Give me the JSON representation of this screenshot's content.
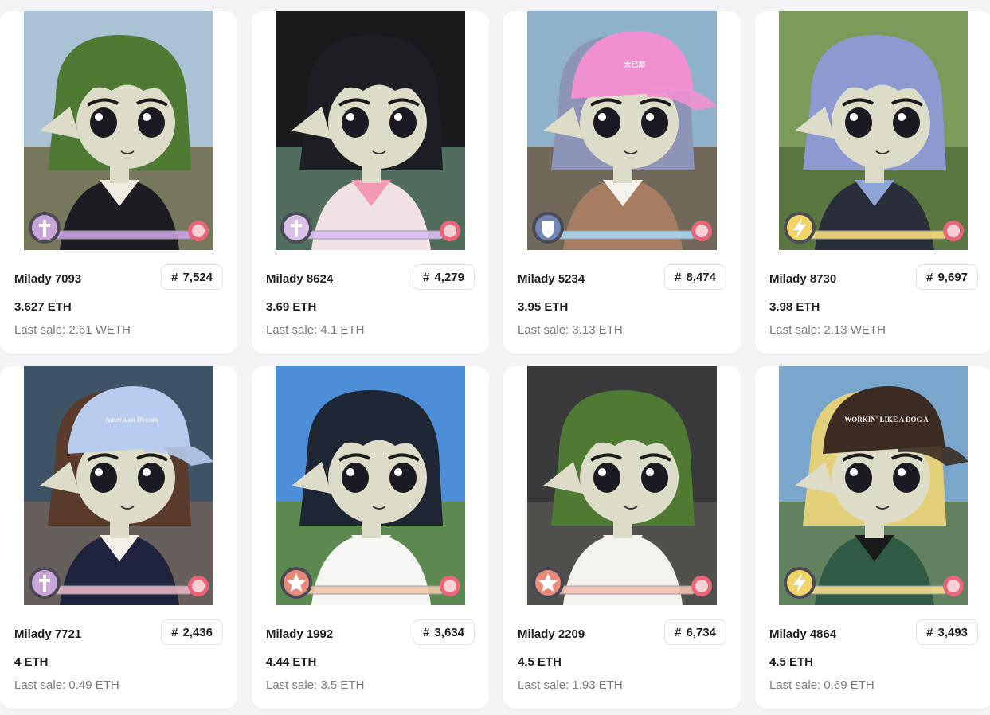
{
  "cards": [
    {
      "name": "Milady 7093",
      "rank_hash": "#",
      "rank": "7,524",
      "price": "3.627 ETH",
      "last_label": "Last sale:",
      "last_value": "2.61 WETH",
      "art": {
        "sky": "#a9c2d6",
        "ground": "#6d6a45",
        "hair": "#4f7a34",
        "outfit": "#1e1c22",
        "collar": "#f1ece2",
        "hat": "none",
        "hat_color": "",
        "hat_text": "",
        "badge": "cross-icon",
        "badge_color": "#c8a4d8",
        "bar": "#c8a4e6"
      }
    },
    {
      "name": "Milady 8624",
      "rank_hash": "#",
      "rank": "4,279",
      "price": "3.69 ETH",
      "last_label": "Last sale:",
      "last_value": "4.1 ETH",
      "art": {
        "sky": "#1a1a1c",
        "ground": "#5a7d6a",
        "hair": "#1d1e24",
        "outfit": "#f0e2e4",
        "collar": "#f39ab4",
        "hat": "none",
        "hat_color": "",
        "hat_text": "",
        "badge": "cross-icon",
        "badge_color": "#d8c0e8",
        "bar": "#d8c0f2"
      }
    },
    {
      "name": "Milady 5234",
      "rank_hash": "#",
      "rank": "8,474",
      "price": "3.95 ETH",
      "last_label": "Last sale:",
      "last_value": "3.13 ETH",
      "art": {
        "sky": "#8fb2cc",
        "ground": "#6b5a45",
        "hair": "#8e93b8",
        "outfit": "#a77d62",
        "collar": "#f5f2ee",
        "hat": "cap",
        "hat_color": "#f08fd0",
        "hat_text": "太巳郎",
        "badge": "shield-icon",
        "badge_color": "#6f86b8",
        "bar": "#a9d6f0"
      }
    },
    {
      "name": "Milady 8730",
      "rank_hash": "#",
      "rank": "9,697",
      "price": "3.98 ETH",
      "last_label": "Last sale:",
      "last_value": "2.13 WETH",
      "art": {
        "sky": "#7c9a5a",
        "ground": "#56703d",
        "hair": "#8d9ad0",
        "outfit": "#2a2e38",
        "collar": "#8da6d8",
        "hat": "none",
        "hat_color": "",
        "hat_text": "",
        "badge": "bolt-icon",
        "badge_color": "#f0d46a",
        "bar": "#f3de7c"
      }
    },
    {
      "name": "Milady 7721",
      "rank_hash": "#",
      "rank": "2,436",
      "price": "4 ETH",
      "last_label": "Last sale:",
      "last_value": "0.49 ETH",
      "art": {
        "sky": "#3d5466",
        "ground": "#6f625a",
        "hair": "#5a3a2a",
        "outfit": "#20233d",
        "collar": "#f3f0ea",
        "hat": "cap",
        "hat_color": "#b8ccef",
        "hat_text": "American Dream",
        "badge": "cross-icon",
        "badge_color": "#c8a4d8",
        "bar": "#e8b6c4"
      }
    },
    {
      "name": "Milady 1992",
      "rank_hash": "#",
      "rank": "3,634",
      "price": "4.44 ETH",
      "last_label": "Last sale:",
      "last_value": "3.5 ETH",
      "art": {
        "sky": "#4d8fd6",
        "ground": "#5f8a3a",
        "hair": "#1e2634",
        "outfit": "#f6f6f4",
        "collar": "#f6f6f4",
        "hat": "none",
        "hat_color": "",
        "hat_text": "",
        "badge": "star-icon",
        "badge_color": "#e88a7a",
        "bar": "#f0c8a8"
      }
    },
    {
      "name": "Milady 2209",
      "rank_hash": "#",
      "rank": "6,734",
      "price": "4.5 ETH",
      "last_label": "Last sale:",
      "last_value": "1.93 ETH",
      "art": {
        "sky": "#3a3a3c",
        "ground": "#55554f",
        "hair": "#4f7a34",
        "outfit": "#f3f2ee",
        "collar": "#f3f2ee",
        "hat": "none",
        "hat_color": "",
        "hat_text": "",
        "badge": "star-icon",
        "badge_color": "#e88a7a",
        "bar": "#f2c2b0"
      }
    },
    {
      "name": "Milady 4864",
      "rank_hash": "#",
      "rank": "3,493",
      "price": "4.5 ETH",
      "last_label": "Last sale:",
      "last_value": "0.69 ETH",
      "art": {
        "sky": "#7aa6cc",
        "ground": "#5e7a4a",
        "hair": "#e4cf7a",
        "outfit": "#2f5a46",
        "collar": "#1a1a1a",
        "hat": "cap",
        "hat_color": "#3a2c22",
        "hat_text": "WORKIN' LIKE A DOG ALL DAY ON MILADY",
        "badge": "bolt-icon",
        "badge_color": "#f0d46a",
        "bar": "#f6df8a"
      }
    }
  ]
}
